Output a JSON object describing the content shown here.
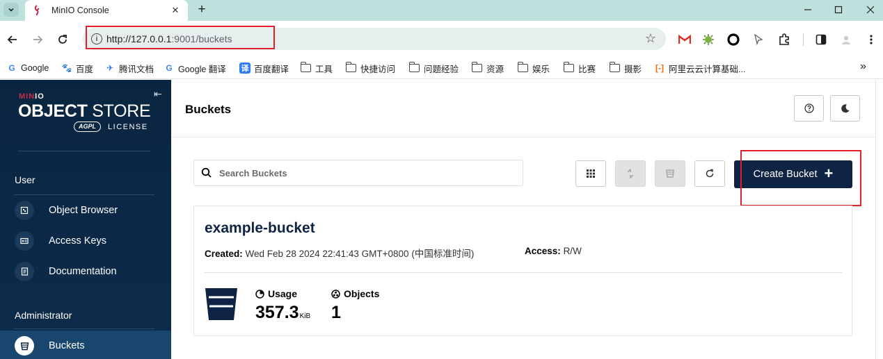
{
  "browser": {
    "tab_title": "MinIO Console",
    "url_host": "http://127.0.0.1",
    "url_path": ":9001/buckets",
    "bookmarks": [
      {
        "label": "Google",
        "icon": "google-icon"
      },
      {
        "label": "百度",
        "icon": "baidu-icon"
      },
      {
        "label": "腾讯文档",
        "icon": "tencent-docs-icon"
      },
      {
        "label": "Google 翻译",
        "icon": "google-translate-icon"
      },
      {
        "label": "百度翻译",
        "icon": "baidu-translate-icon"
      },
      {
        "label": "工具",
        "icon": "folder-icon"
      },
      {
        "label": "快捷访问",
        "icon": "folder-icon"
      },
      {
        "label": "问题经验",
        "icon": "folder-icon"
      },
      {
        "label": "资源",
        "icon": "folder-icon"
      },
      {
        "label": "娱乐",
        "icon": "folder-icon"
      },
      {
        "label": "比赛",
        "icon": "folder-icon"
      },
      {
        "label": "摄影",
        "icon": "folder-icon"
      },
      {
        "label": "阿里云云计算基础...",
        "icon": "aliyun-icon"
      }
    ]
  },
  "sidebar": {
    "logo_minio_prefix": "MIN",
    "logo_minio_suffix": "IO",
    "logo_object": "OBJECT",
    "logo_store": " STORE",
    "logo_agpl": "AGPL",
    "logo_license": "LICENSE",
    "section_user": "User",
    "section_admin": "Administrator",
    "items": [
      {
        "label": "Object Browser",
        "icon": "object-browser-icon"
      },
      {
        "label": "Access Keys",
        "icon": "access-keys-icon"
      },
      {
        "label": "Documentation",
        "icon": "documentation-icon"
      },
      {
        "label": "Buckets",
        "icon": "buckets-icon",
        "active": true
      }
    ]
  },
  "main": {
    "title": "Buckets",
    "search_placeholder": "Search Buckets",
    "create_button": "Create Bucket",
    "bucket": {
      "name": "example-bucket",
      "created_label": "Created:",
      "created_value": "Wed Feb 28 2024 22:41:43 GMT+0800 (中国标准时间)",
      "access_label": "Access:",
      "access_value": "R/W",
      "usage_label": "Usage",
      "usage_value": "357.3",
      "usage_unit": "KiB",
      "objects_label": "Objects",
      "objects_value": "1"
    }
  },
  "colors": {
    "sidebar_bg": "#0a2540",
    "primary_button": "#0f2345",
    "highlight_box": "#e0202a"
  }
}
